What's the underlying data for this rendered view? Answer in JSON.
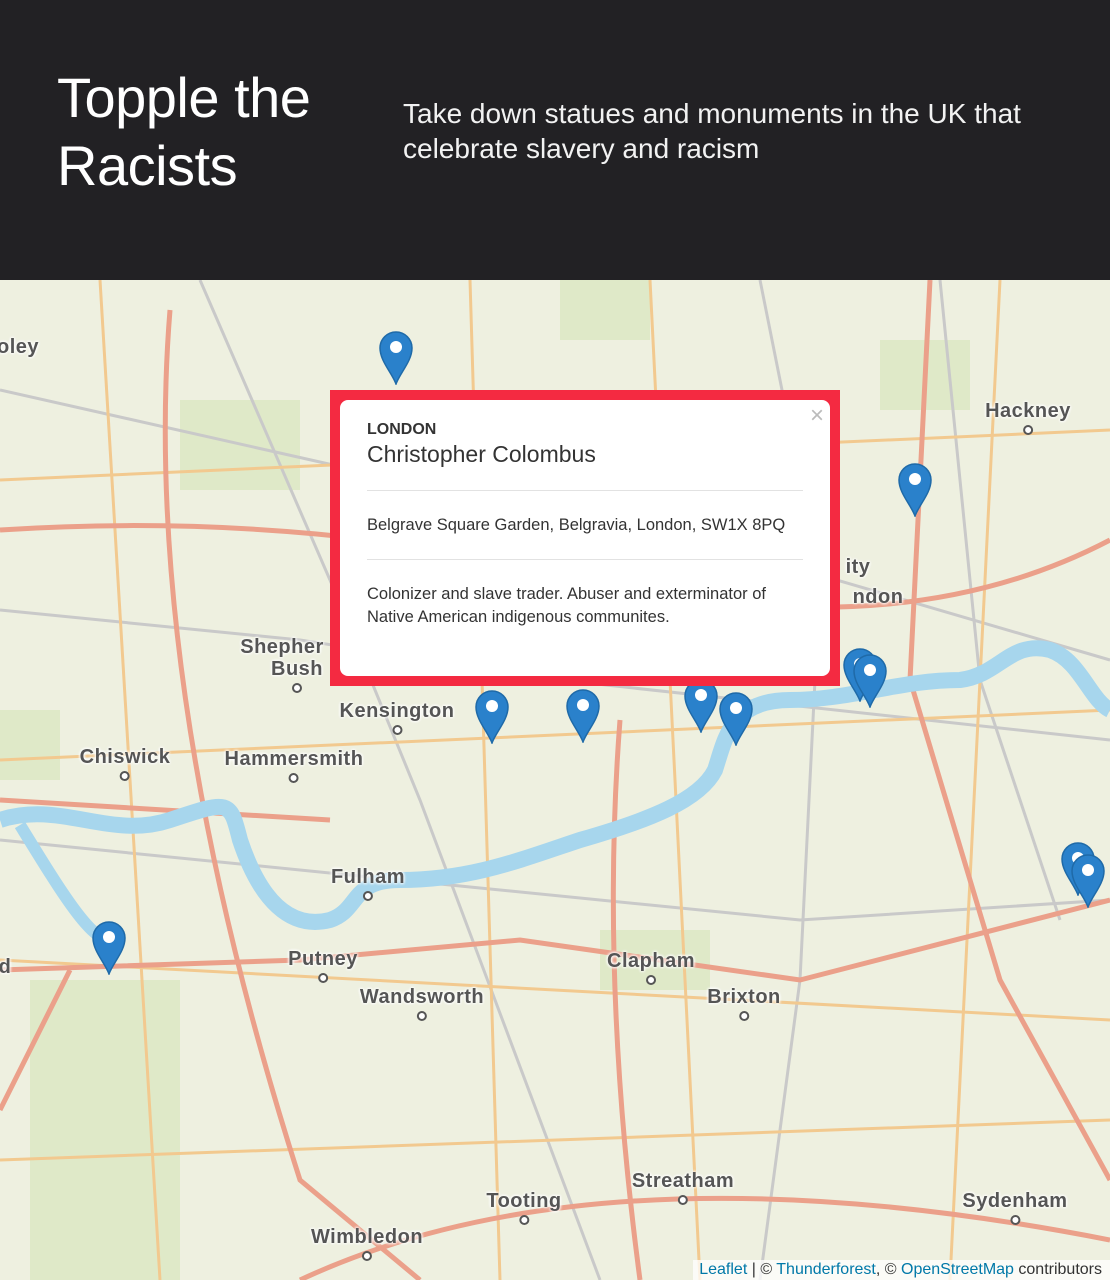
{
  "header": {
    "title": "Topple the Racists",
    "tagline": "Take down statues and monuments in the UK that celebrate slavery and racism"
  },
  "map": {
    "place_labels": [
      "oley",
      "Hackney",
      "ity",
      "ndon",
      "Shepher",
      "Bush",
      "Kensington",
      "Chiswick",
      "Hammersmith",
      "Fulham",
      "Putney",
      "Wandsworth",
      "Clapham",
      "Brixton",
      "Streatham",
      "Tooting",
      "Wimbledon",
      "Sydenham",
      "d"
    ],
    "marker_icon": "map-pin-icon",
    "marker_color": "#2a81cb",
    "marker_count": 11,
    "popup": {
      "city": "LONDON",
      "name": "Christopher Colombus",
      "address": "Belgrave Square Garden, Belgravia, London, SW1X 8PQ",
      "description": "Colonizer and slave trader. Abuser and exterminator of Native American indigenous communites.",
      "close_label": "×",
      "highlight_color": "#f42a41"
    },
    "attribution": {
      "leaflet": "Leaflet",
      "sep1": " | © ",
      "thunderforest": "Thunderforest",
      "sep2": ", © ",
      "osm": "OpenStreetMap",
      "contributors": " contributors"
    }
  }
}
